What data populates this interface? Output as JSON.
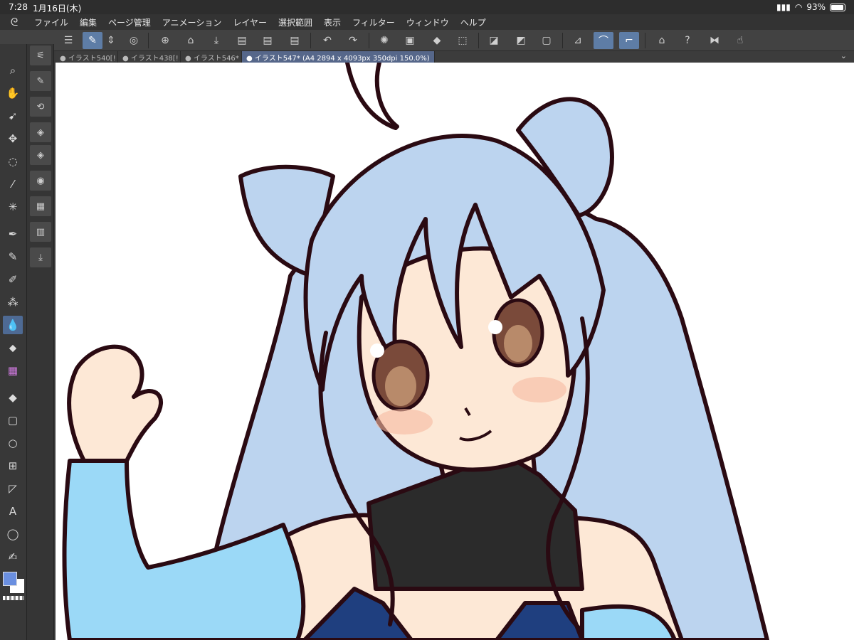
{
  "status": {
    "time": "7:28",
    "date": "1月16日(木)",
    "battery": "93%"
  },
  "menu": {
    "items": [
      "ファイル",
      "編集",
      "ページ管理",
      "アニメーション",
      "レイヤー",
      "選択範囲",
      "表示",
      "フィルター",
      "ウィンドウ",
      "ヘルプ"
    ]
  },
  "tabs": [
    {
      "label": "● イラスト540[!"
    },
    {
      "label": "● イラスト438[!"
    },
    {
      "label": "● イラスト546*"
    },
    {
      "label": "● イラスト547* (A4 2894 x 4093px 350dpi 150.0%)"
    }
  ],
  "colors": {
    "main": "#6a8fe0",
    "sub": "#ffffff",
    "hair": "#bcd4ef",
    "skin": "#fde8d6",
    "line": "#2a0a12",
    "sleeve": "#9bd9f7",
    "collar": "#2b2b2b",
    "dress": "#1f3f7f"
  }
}
